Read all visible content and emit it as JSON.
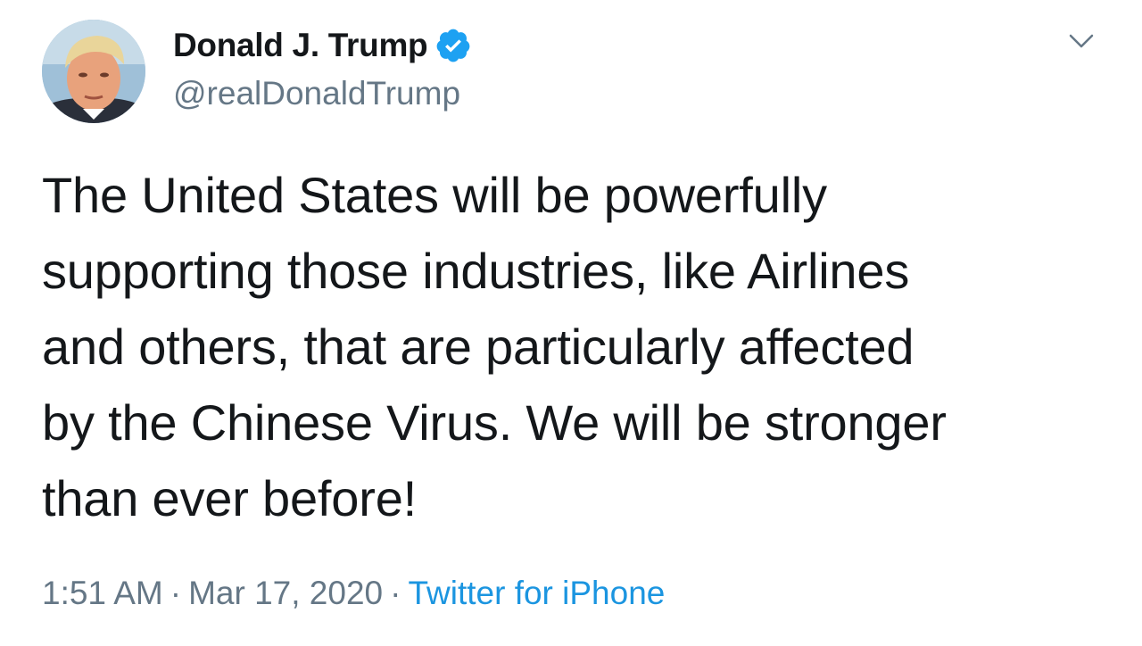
{
  "user": {
    "display_name": "Donald J. Trump",
    "handle": "@realDonaldTrump",
    "verified": true
  },
  "tweet": {
    "lines": [
      "The United States will be powerfully",
      "supporting those industries, like Airlines",
      "and others, that are particularly affected",
      "by the Chinese Virus. We will be stronger",
      "than ever before!"
    ],
    "time": "1:51 AM",
    "date": "Mar 17, 2020",
    "separator": "·",
    "source": "Twitter for iPhone"
  },
  "icons": {
    "verified": "verified-badge-icon",
    "menu": "chevron-down-icon"
  },
  "colors": {
    "text": "#14171a",
    "secondary": "#657786",
    "accent": "#1b95e0",
    "verified": "#1da1f2"
  }
}
